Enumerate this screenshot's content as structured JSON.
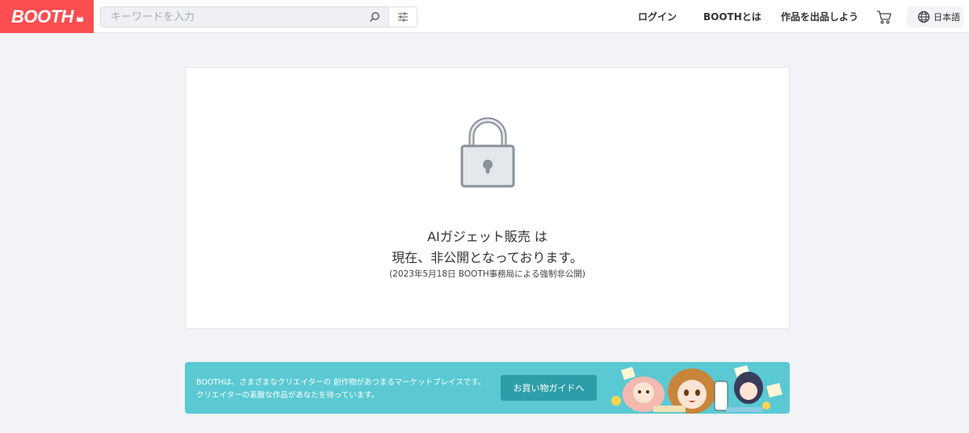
{
  "header": {
    "logo_text": "BOOTH",
    "search": {
      "placeholder": "キーワードを入力",
      "value": ""
    },
    "search_icon": "search-icon",
    "filter_icon": "sliders-icon",
    "nav": {
      "login": "ログイン",
      "about": "BOOTHとは",
      "sell": "作品を出品しよう"
    },
    "cart_icon": "cart-icon",
    "language": {
      "icon": "globe-icon",
      "label": "日本語"
    }
  },
  "notice": {
    "icon": "lock-icon",
    "line1": "AIガジェット販売 は",
    "line2": "現在、非公開となっております。",
    "note": "(2023年5月18日 BOOTH事務局による強制非公開)"
  },
  "banner": {
    "line1": "BOOTHは、さまざまなクリエイターの 創作物があつまるマーケットプレイスです。",
    "line2": "クリエイターの素敵な作品があなたを待っています。",
    "button_label": "お買い物ガイドへ",
    "illustration": "characters-illustration"
  },
  "colors": {
    "brand": "#fc4d50",
    "banner_bg": "#5ac9d3",
    "banner_button": "#2b9ea8",
    "page_bg": "#f1f3f6"
  }
}
